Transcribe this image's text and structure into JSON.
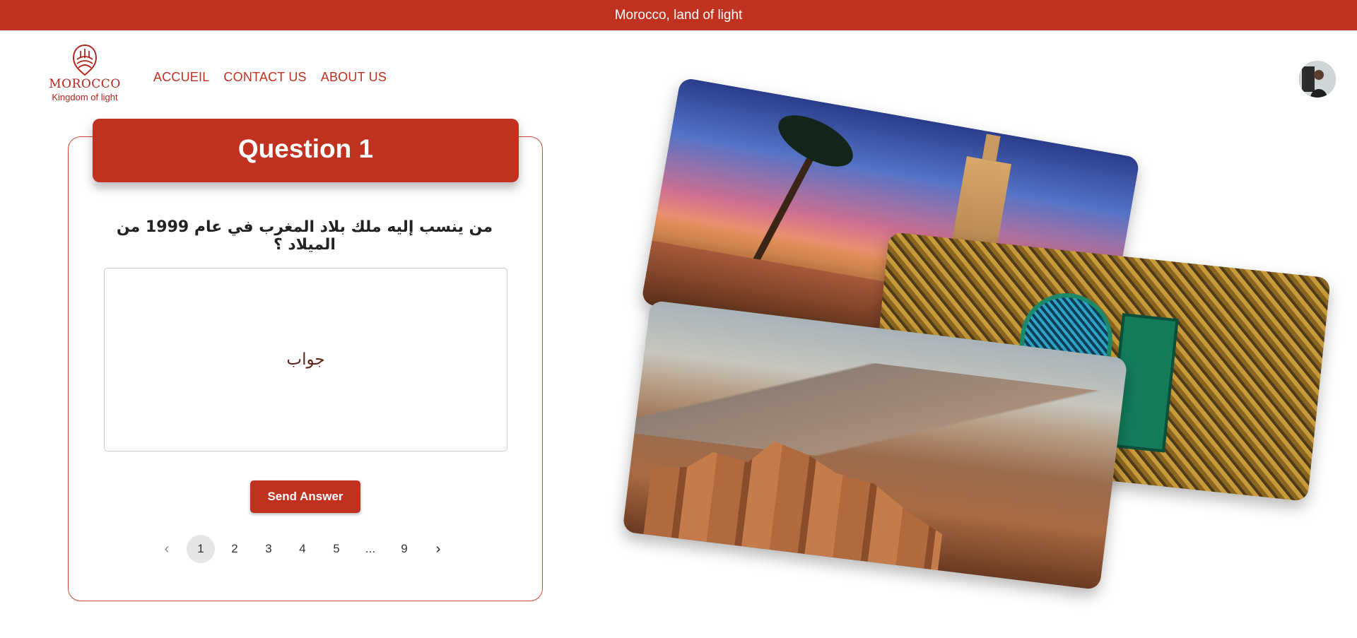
{
  "banner": {
    "text": "Morocco, land of light"
  },
  "logo": {
    "title": "MOROCCO",
    "subtitle": "Kingdom of light"
  },
  "nav": {
    "items": [
      {
        "label": "ACCUEIL"
      },
      {
        "label": "CONTACT US"
      },
      {
        "label": "ABOUT US"
      }
    ]
  },
  "user": {
    "avatar": "avatar"
  },
  "quiz": {
    "header": "Question 1",
    "question": "من ينسب إليه ملك بلاد المغرب في عام 1999 من الميلاد ؟",
    "answer_placeholder": "جواب",
    "send_label": "Send Answer"
  },
  "pagination": {
    "prev_icon": "chevron-left-icon",
    "next_icon": "chevron-right-icon",
    "pages": [
      "1",
      "2",
      "3",
      "4",
      "5",
      "...",
      "9"
    ],
    "current": "1"
  },
  "colors": {
    "accent": "#c0321f",
    "accent_dark": "#b3261e"
  }
}
